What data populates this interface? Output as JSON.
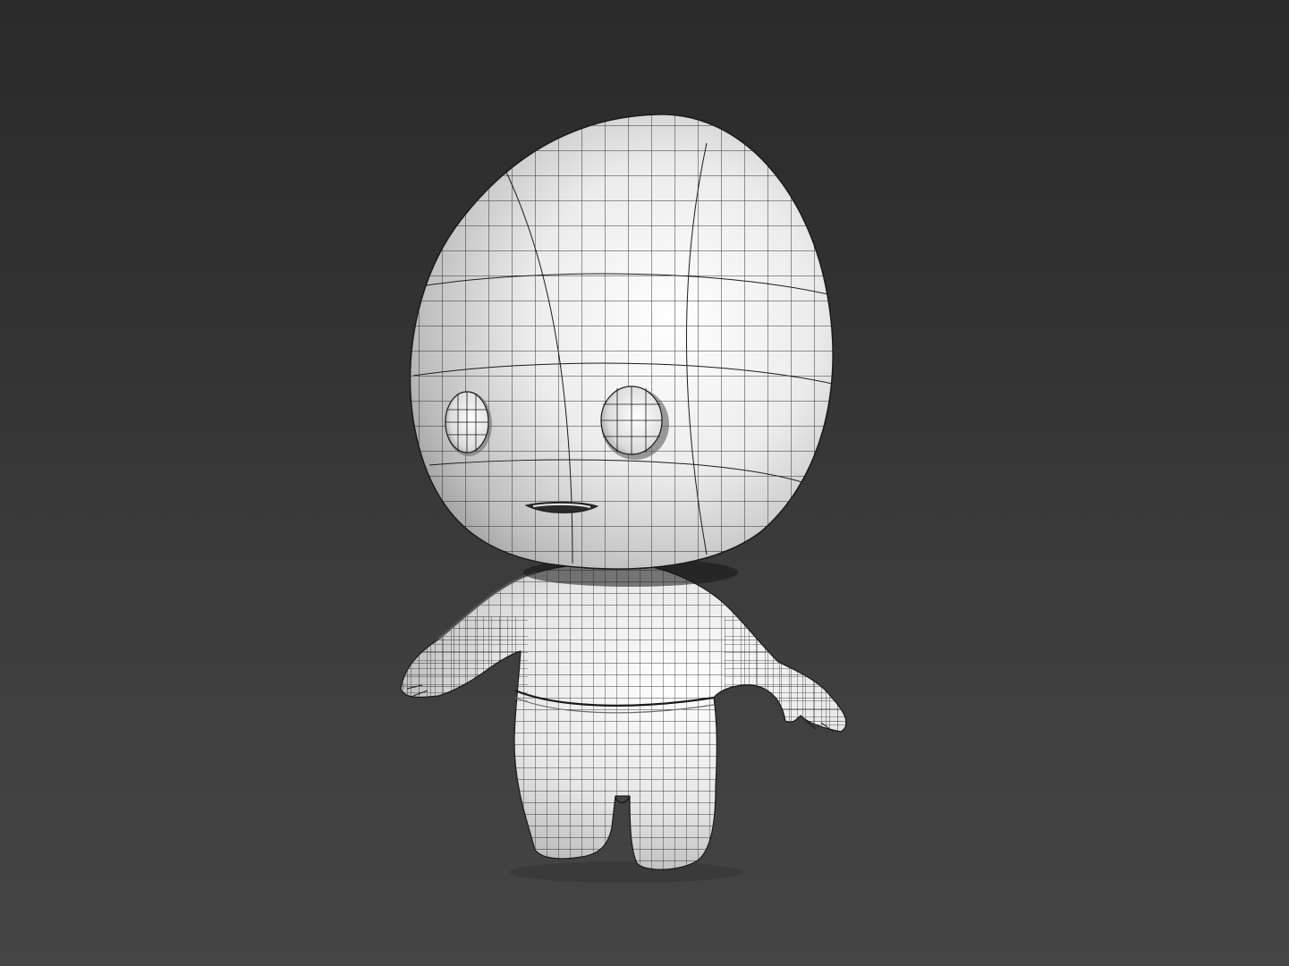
{
  "viewport": {
    "background_top": "#2a2a2a",
    "background_bottom": "#454545",
    "shading_mode": "smooth-with-wireframe",
    "mesh_color": "#f2f2f2",
    "wire_color": "#1a1a1a"
  },
  "model": {
    "type": "character-mesh",
    "parts": [
      "head",
      "left-eye",
      "right-eye",
      "mouth",
      "torso",
      "left-arm",
      "right-arm",
      "shorts",
      "left-leg",
      "right-leg"
    ]
  }
}
